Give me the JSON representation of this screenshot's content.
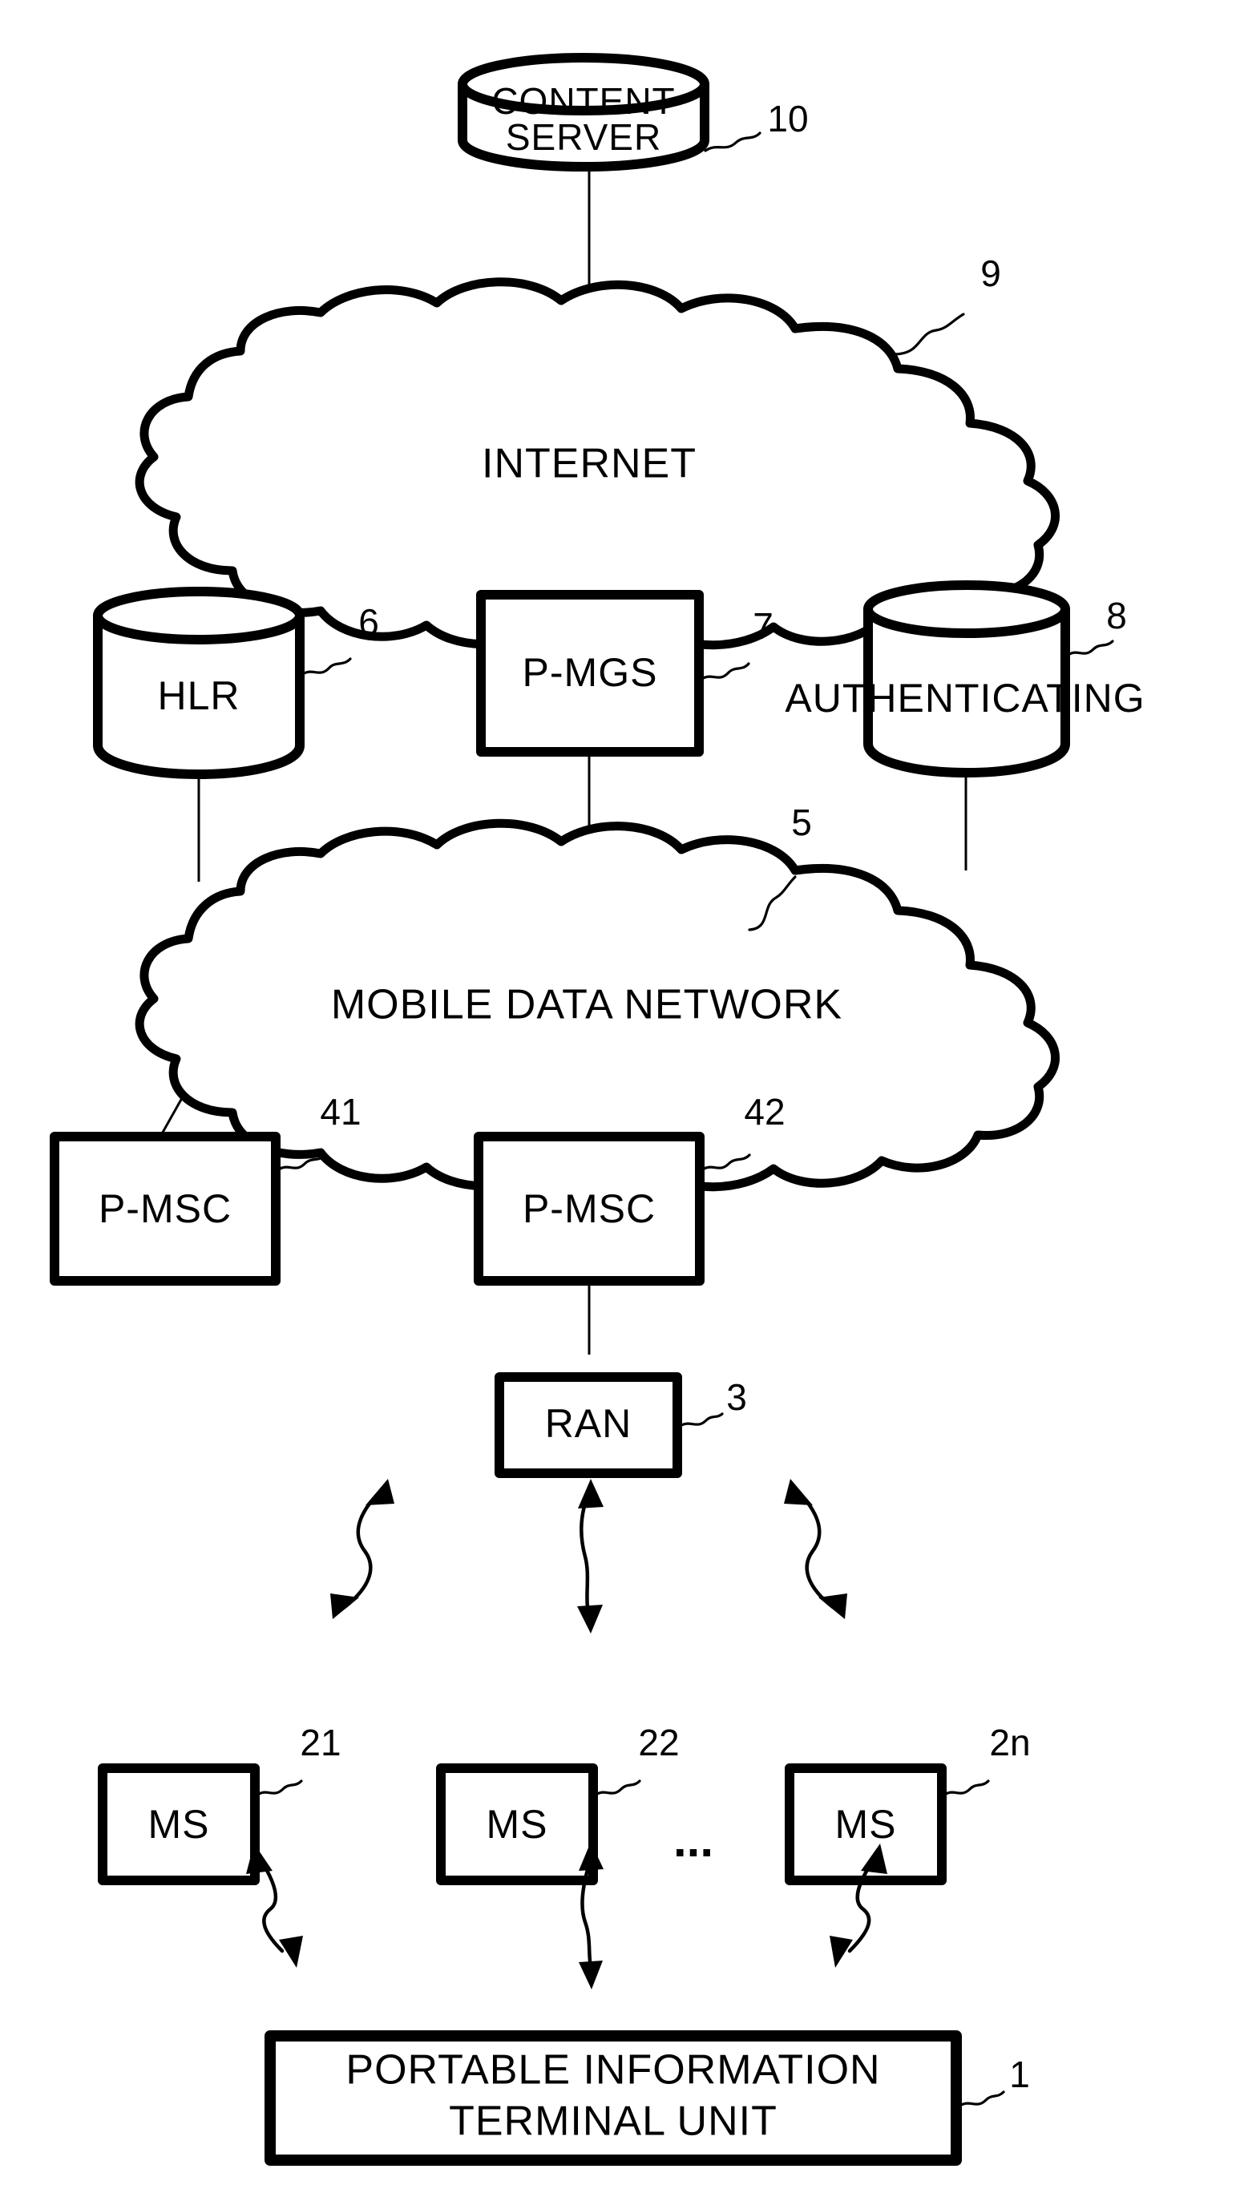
{
  "figure": {
    "type": "patent-network-diagram",
    "background_color": "#ffffff",
    "line_color": "#000000"
  },
  "nodes": {
    "content_server": {
      "label_line1": "CONTENT",
      "label_line2": "SERVER",
      "ref": "10",
      "shape": "cylinder"
    },
    "internet": {
      "label": "INTERNET",
      "ref": "9",
      "shape": "cloud"
    },
    "hlr": {
      "label": "HLR",
      "ref": "6",
      "shape": "cylinder"
    },
    "pmgs": {
      "label": "P-MGS",
      "ref": "7",
      "shape": "rect"
    },
    "authenticating": {
      "label": "AUTHENTICATING",
      "ref": "8",
      "shape": "cylinder"
    },
    "mobile_data_network": {
      "label": "MOBILE DATA NETWORK",
      "ref": "5",
      "shape": "cloud"
    },
    "pmsc_left": {
      "label": "P-MSC",
      "ref": "41",
      "shape": "rect"
    },
    "pmsc_right": {
      "label": "P-MSC",
      "ref": "42",
      "shape": "rect"
    },
    "ran": {
      "label": "RAN",
      "ref": "3",
      "shape": "rect"
    },
    "ms_1": {
      "label": "MS",
      "ref": "21",
      "shape": "rect"
    },
    "ms_2": {
      "label": "MS",
      "ref": "22",
      "shape": "rect"
    },
    "ms_n": {
      "label": "MS",
      "ref": "2n",
      "shape": "rect"
    },
    "ellipsis": {
      "label": "..."
    },
    "terminal": {
      "label_line1": "PORTABLE INFORMATION",
      "label_line2": "TERMINAL UNIT",
      "ref": "1",
      "shape": "rect"
    }
  }
}
